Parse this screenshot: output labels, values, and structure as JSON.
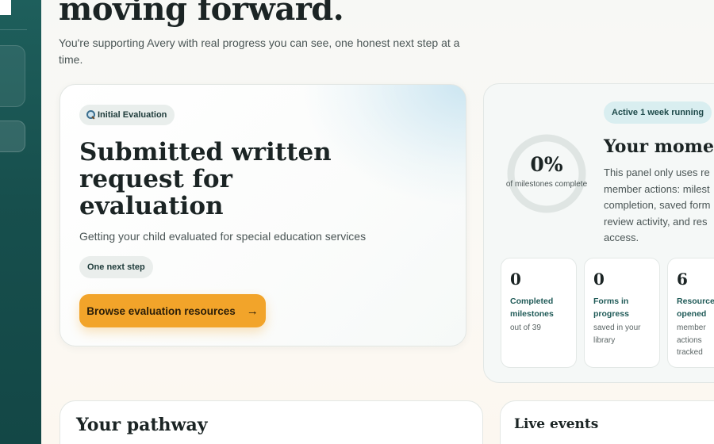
{
  "hero": {
    "title": "moving forward.",
    "subtitle": "You're supporting Avery with real progress you can see, one honest next step at a time."
  },
  "focus_card": {
    "stage_label": "Initial Evaluation",
    "stage_icon": "magnifying-glass-icon",
    "title": "Submitted written request for evaluation",
    "description": "Getting your child evaluated for special education services",
    "step_label": "One next step",
    "cta_label": "Browse evaluation resources",
    "cta_arrow": "→",
    "cta_color": "#f2a42a"
  },
  "momentum": {
    "active_label": "Active 1 week running",
    "title": "Your momentu",
    "description": "This panel only uses re\nmember actions: milest\ncompletion, saved form\nreview activity, and res\naccess.",
    "progress_value": "0%",
    "progress_fraction": 0,
    "progress_label": "of milestones complete",
    "stats": [
      {
        "value": "0",
        "label": "Completed\nmilestones",
        "sub": "out of 39"
      },
      {
        "value": "0",
        "label": "Forms in\nprogress",
        "sub": "saved in your\nlibrary"
      },
      {
        "value": "6",
        "label": "Resource\nopened",
        "sub": "member\nactions\ntracked"
      }
    ]
  },
  "pathway": {
    "title": "Your pathway"
  },
  "events": {
    "title": "Live events"
  },
  "colors": {
    "sidebar": "#1e5f5c",
    "accent": "#f2a42a",
    "pill_active": "#d9eef0",
    "ring_track": "#dfe5e3"
  }
}
